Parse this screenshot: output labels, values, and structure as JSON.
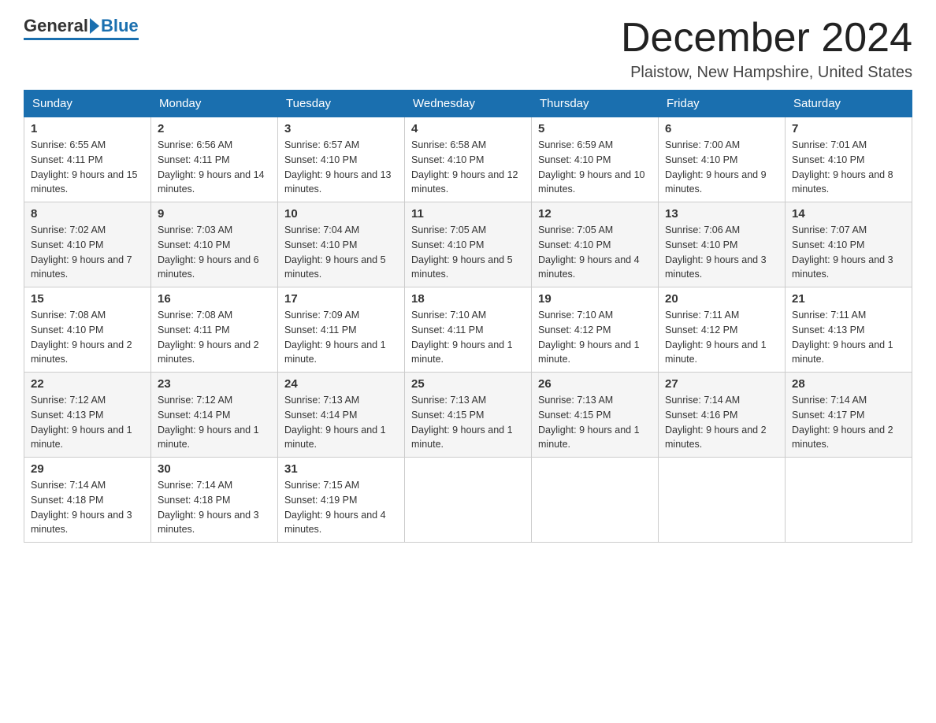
{
  "header": {
    "logo_general": "General",
    "logo_blue": "Blue",
    "month_title": "December 2024",
    "location": "Plaistow, New Hampshire, United States"
  },
  "weekdays": [
    "Sunday",
    "Monday",
    "Tuesday",
    "Wednesday",
    "Thursday",
    "Friday",
    "Saturday"
  ],
  "weeks": [
    [
      {
        "day": 1,
        "sunrise": "6:55 AM",
        "sunset": "4:11 PM",
        "daylight": "9 hours and 15 minutes."
      },
      {
        "day": 2,
        "sunrise": "6:56 AM",
        "sunset": "4:11 PM",
        "daylight": "9 hours and 14 minutes."
      },
      {
        "day": 3,
        "sunrise": "6:57 AM",
        "sunset": "4:10 PM",
        "daylight": "9 hours and 13 minutes."
      },
      {
        "day": 4,
        "sunrise": "6:58 AM",
        "sunset": "4:10 PM",
        "daylight": "9 hours and 12 minutes."
      },
      {
        "day": 5,
        "sunrise": "6:59 AM",
        "sunset": "4:10 PM",
        "daylight": "9 hours and 10 minutes."
      },
      {
        "day": 6,
        "sunrise": "7:00 AM",
        "sunset": "4:10 PM",
        "daylight": "9 hours and 9 minutes."
      },
      {
        "day": 7,
        "sunrise": "7:01 AM",
        "sunset": "4:10 PM",
        "daylight": "9 hours and 8 minutes."
      }
    ],
    [
      {
        "day": 8,
        "sunrise": "7:02 AM",
        "sunset": "4:10 PM",
        "daylight": "9 hours and 7 minutes."
      },
      {
        "day": 9,
        "sunrise": "7:03 AM",
        "sunset": "4:10 PM",
        "daylight": "9 hours and 6 minutes."
      },
      {
        "day": 10,
        "sunrise": "7:04 AM",
        "sunset": "4:10 PM",
        "daylight": "9 hours and 5 minutes."
      },
      {
        "day": 11,
        "sunrise": "7:05 AM",
        "sunset": "4:10 PM",
        "daylight": "9 hours and 5 minutes."
      },
      {
        "day": 12,
        "sunrise": "7:05 AM",
        "sunset": "4:10 PM",
        "daylight": "9 hours and 4 minutes."
      },
      {
        "day": 13,
        "sunrise": "7:06 AM",
        "sunset": "4:10 PM",
        "daylight": "9 hours and 3 minutes."
      },
      {
        "day": 14,
        "sunrise": "7:07 AM",
        "sunset": "4:10 PM",
        "daylight": "9 hours and 3 minutes."
      }
    ],
    [
      {
        "day": 15,
        "sunrise": "7:08 AM",
        "sunset": "4:10 PM",
        "daylight": "9 hours and 2 minutes."
      },
      {
        "day": 16,
        "sunrise": "7:08 AM",
        "sunset": "4:11 PM",
        "daylight": "9 hours and 2 minutes."
      },
      {
        "day": 17,
        "sunrise": "7:09 AM",
        "sunset": "4:11 PM",
        "daylight": "9 hours and 1 minute."
      },
      {
        "day": 18,
        "sunrise": "7:10 AM",
        "sunset": "4:11 PM",
        "daylight": "9 hours and 1 minute."
      },
      {
        "day": 19,
        "sunrise": "7:10 AM",
        "sunset": "4:12 PM",
        "daylight": "9 hours and 1 minute."
      },
      {
        "day": 20,
        "sunrise": "7:11 AM",
        "sunset": "4:12 PM",
        "daylight": "9 hours and 1 minute."
      },
      {
        "day": 21,
        "sunrise": "7:11 AM",
        "sunset": "4:13 PM",
        "daylight": "9 hours and 1 minute."
      }
    ],
    [
      {
        "day": 22,
        "sunrise": "7:12 AM",
        "sunset": "4:13 PM",
        "daylight": "9 hours and 1 minute."
      },
      {
        "day": 23,
        "sunrise": "7:12 AM",
        "sunset": "4:14 PM",
        "daylight": "9 hours and 1 minute."
      },
      {
        "day": 24,
        "sunrise": "7:13 AM",
        "sunset": "4:14 PM",
        "daylight": "9 hours and 1 minute."
      },
      {
        "day": 25,
        "sunrise": "7:13 AM",
        "sunset": "4:15 PM",
        "daylight": "9 hours and 1 minute."
      },
      {
        "day": 26,
        "sunrise": "7:13 AM",
        "sunset": "4:15 PM",
        "daylight": "9 hours and 1 minute."
      },
      {
        "day": 27,
        "sunrise": "7:14 AM",
        "sunset": "4:16 PM",
        "daylight": "9 hours and 2 minutes."
      },
      {
        "day": 28,
        "sunrise": "7:14 AM",
        "sunset": "4:17 PM",
        "daylight": "9 hours and 2 minutes."
      }
    ],
    [
      {
        "day": 29,
        "sunrise": "7:14 AM",
        "sunset": "4:18 PM",
        "daylight": "9 hours and 3 minutes."
      },
      {
        "day": 30,
        "sunrise": "7:14 AM",
        "sunset": "4:18 PM",
        "daylight": "9 hours and 3 minutes."
      },
      {
        "day": 31,
        "sunrise": "7:15 AM",
        "sunset": "4:19 PM",
        "daylight": "9 hours and 4 minutes."
      },
      null,
      null,
      null,
      null
    ]
  ]
}
